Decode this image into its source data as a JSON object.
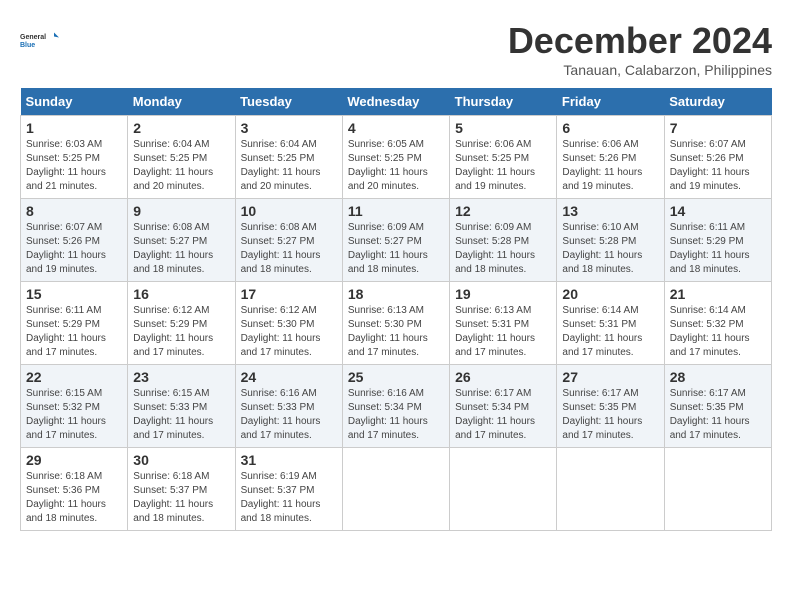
{
  "header": {
    "logo_text_general": "General",
    "logo_text_blue": "Blue",
    "month_title": "December 2024",
    "location": "Tanauan, Calabarzon, Philippines"
  },
  "calendar": {
    "weekdays": [
      "Sunday",
      "Monday",
      "Tuesday",
      "Wednesday",
      "Thursday",
      "Friday",
      "Saturday"
    ],
    "weeks": [
      [
        {
          "day": "",
          "empty": true
        },
        {
          "day": "",
          "empty": true
        },
        {
          "day": "",
          "empty": true
        },
        {
          "day": "",
          "empty": true
        },
        {
          "day": "",
          "empty": true
        },
        {
          "day": "",
          "empty": true
        },
        {
          "day": "",
          "empty": true
        }
      ],
      [
        {
          "day": "1",
          "info": "Sunrise: 6:03 AM\nSunset: 5:25 PM\nDaylight: 11 hours\nand 21 minutes."
        },
        {
          "day": "2",
          "info": "Sunrise: 6:04 AM\nSunset: 5:25 PM\nDaylight: 11 hours\nand 20 minutes."
        },
        {
          "day": "3",
          "info": "Sunrise: 6:04 AM\nSunset: 5:25 PM\nDaylight: 11 hours\nand 20 minutes."
        },
        {
          "day": "4",
          "info": "Sunrise: 6:05 AM\nSunset: 5:25 PM\nDaylight: 11 hours\nand 20 minutes."
        },
        {
          "day": "5",
          "info": "Sunrise: 6:06 AM\nSunset: 5:25 PM\nDaylight: 11 hours\nand 19 minutes."
        },
        {
          "day": "6",
          "info": "Sunrise: 6:06 AM\nSunset: 5:26 PM\nDaylight: 11 hours\nand 19 minutes."
        },
        {
          "day": "7",
          "info": "Sunrise: 6:07 AM\nSunset: 5:26 PM\nDaylight: 11 hours\nand 19 minutes."
        }
      ],
      [
        {
          "day": "8",
          "info": "Sunrise: 6:07 AM\nSunset: 5:26 PM\nDaylight: 11 hours\nand 19 minutes."
        },
        {
          "day": "9",
          "info": "Sunrise: 6:08 AM\nSunset: 5:27 PM\nDaylight: 11 hours\nand 18 minutes."
        },
        {
          "day": "10",
          "info": "Sunrise: 6:08 AM\nSunset: 5:27 PM\nDaylight: 11 hours\nand 18 minutes."
        },
        {
          "day": "11",
          "info": "Sunrise: 6:09 AM\nSunset: 5:27 PM\nDaylight: 11 hours\nand 18 minutes."
        },
        {
          "day": "12",
          "info": "Sunrise: 6:09 AM\nSunset: 5:28 PM\nDaylight: 11 hours\nand 18 minutes."
        },
        {
          "day": "13",
          "info": "Sunrise: 6:10 AM\nSunset: 5:28 PM\nDaylight: 11 hours\nand 18 minutes."
        },
        {
          "day": "14",
          "info": "Sunrise: 6:11 AM\nSunset: 5:29 PM\nDaylight: 11 hours\nand 18 minutes."
        }
      ],
      [
        {
          "day": "15",
          "info": "Sunrise: 6:11 AM\nSunset: 5:29 PM\nDaylight: 11 hours\nand 17 minutes."
        },
        {
          "day": "16",
          "info": "Sunrise: 6:12 AM\nSunset: 5:29 PM\nDaylight: 11 hours\nand 17 minutes."
        },
        {
          "day": "17",
          "info": "Sunrise: 6:12 AM\nSunset: 5:30 PM\nDaylight: 11 hours\nand 17 minutes."
        },
        {
          "day": "18",
          "info": "Sunrise: 6:13 AM\nSunset: 5:30 PM\nDaylight: 11 hours\nand 17 minutes."
        },
        {
          "day": "19",
          "info": "Sunrise: 6:13 AM\nSunset: 5:31 PM\nDaylight: 11 hours\nand 17 minutes."
        },
        {
          "day": "20",
          "info": "Sunrise: 6:14 AM\nSunset: 5:31 PM\nDaylight: 11 hours\nand 17 minutes."
        },
        {
          "day": "21",
          "info": "Sunrise: 6:14 AM\nSunset: 5:32 PM\nDaylight: 11 hours\nand 17 minutes."
        }
      ],
      [
        {
          "day": "22",
          "info": "Sunrise: 6:15 AM\nSunset: 5:32 PM\nDaylight: 11 hours\nand 17 minutes."
        },
        {
          "day": "23",
          "info": "Sunrise: 6:15 AM\nSunset: 5:33 PM\nDaylight: 11 hours\nand 17 minutes."
        },
        {
          "day": "24",
          "info": "Sunrise: 6:16 AM\nSunset: 5:33 PM\nDaylight: 11 hours\nand 17 minutes."
        },
        {
          "day": "25",
          "info": "Sunrise: 6:16 AM\nSunset: 5:34 PM\nDaylight: 11 hours\nand 17 minutes."
        },
        {
          "day": "26",
          "info": "Sunrise: 6:17 AM\nSunset: 5:34 PM\nDaylight: 11 hours\nand 17 minutes."
        },
        {
          "day": "27",
          "info": "Sunrise: 6:17 AM\nSunset: 5:35 PM\nDaylight: 11 hours\nand 17 minutes."
        },
        {
          "day": "28",
          "info": "Sunrise: 6:17 AM\nSunset: 5:35 PM\nDaylight: 11 hours\nand 17 minutes."
        }
      ],
      [
        {
          "day": "29",
          "info": "Sunrise: 6:18 AM\nSunset: 5:36 PM\nDaylight: 11 hours\nand 18 minutes."
        },
        {
          "day": "30",
          "info": "Sunrise: 6:18 AM\nSunset: 5:37 PM\nDaylight: 11 hours\nand 18 minutes."
        },
        {
          "day": "31",
          "info": "Sunrise: 6:19 AM\nSunset: 5:37 PM\nDaylight: 11 hours\nand 18 minutes."
        },
        {
          "day": "",
          "empty": true
        },
        {
          "day": "",
          "empty": true
        },
        {
          "day": "",
          "empty": true
        },
        {
          "day": "",
          "empty": true
        }
      ]
    ]
  }
}
